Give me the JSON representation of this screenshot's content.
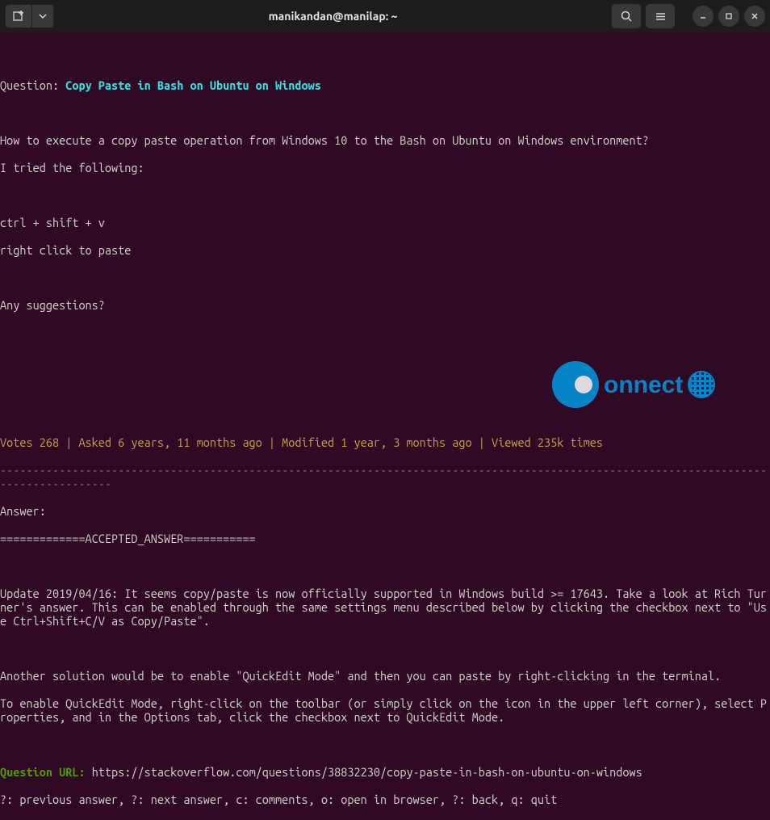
{
  "titlebar": {
    "title": "manikandan@manilap: ~"
  },
  "content": {
    "question_label": "Question: ",
    "question_title": "Copy Paste in Bash on Ubuntu on Windows",
    "body_1": "How to execute a copy paste operation from Windows 10 to the Bash on Ubuntu on Windows environment?",
    "body_2": "I tried the following:",
    "body_3": "ctrl + shift + v",
    "body_4": "right click to paste",
    "body_5": "Any suggestions?",
    "meta": "Votes 268 | Asked 6 years, 11 months ago | Modified 1 year, 3 months ago | Viewed 235k times",
    "divider": "--------------------------------------------------------------------------------------------------------------------------------------",
    "answer_label": "Answer:",
    "accepted": "=============ACCEPTED_ANSWER===========",
    "ans_1": "Update 2019/04/16: It seems copy/paste is now officially supported in Windows build >= 17643. Take a look at Rich Turner's answer. This can be enabled through the same settings menu described below by clicking the checkbox next to \"Use Ctrl+Shift+C/V as Copy/Paste\".",
    "ans_2": "Another solution would be to enable \"QuickEdit Mode\" and then you can paste by right-clicking in the terminal.",
    "ans_3": "To enable QuickEdit Mode, right-click on the toolbar (or simply click on the icon in the upper left corner), select Properties, and in the Options tab, click the checkbox next to QuickEdit Mode.",
    "url_label": "Question URL: ",
    "url": "https://stackoverflow.com/questions/38832230/copy-paste-in-bash-on-ubuntu-on-windows",
    "help": "?: previous answer, ?: next answer, c: comments, o: open in browser, ?: back, q: quit"
  },
  "watermark": {
    "text": "onnect"
  }
}
